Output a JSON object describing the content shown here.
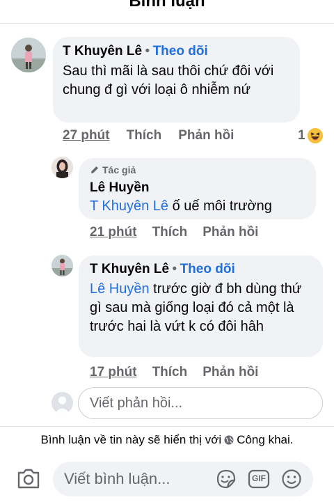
{
  "header": {
    "title": "Bình luận"
  },
  "comments": [
    {
      "author": "T Khuyên Lê",
      "dot": "•",
      "follow": "Theo dõi",
      "text": "Sau thì mãi là sau thôi chứ đôi với chung đ gì với loại ô nhiễm nứ",
      "time": "27 phút",
      "like": "Thích",
      "reply": "Phản hồi",
      "reaction_count": "1",
      "reaction_icon": "haha-icon"
    }
  ],
  "replies": [
    {
      "badge": "Tác giả",
      "badge_icon": "pencil-icon",
      "author": "Lê Huyền",
      "mention": "T Khuyên Lê",
      "text": " ố uế môi trường",
      "time": "21 phút",
      "like": "Thích",
      "reply": "Phản hồi"
    },
    {
      "author": "T Khuyên Lê",
      "dot": "•",
      "follow": "Theo dõi",
      "mention": "Lê Huyền",
      "text": " trước giờ đ bh dùng thứ gì sau mà giống loại đó cả một là trước hai là vứt k có đôi hâh",
      "time": "17 phút",
      "like": "Thích",
      "reply": "Phản hồi"
    }
  ],
  "reply_input": {
    "placeholder": "Viết phản hồi..."
  },
  "notice": {
    "text_before": "Bình luận về tin này sẽ hiển thị với",
    "audience": "Công khai.",
    "icon": "globe-icon"
  },
  "composer": {
    "placeholder": "Viết bình luận...",
    "icons": [
      "camera-icon",
      "sticker-icon",
      "gif-icon",
      "emoji-icon"
    ],
    "gif_label": "GIF"
  },
  "colors": {
    "link": "#216fdb",
    "secondary": "#65676b",
    "bubble": "#f0f2f5"
  }
}
